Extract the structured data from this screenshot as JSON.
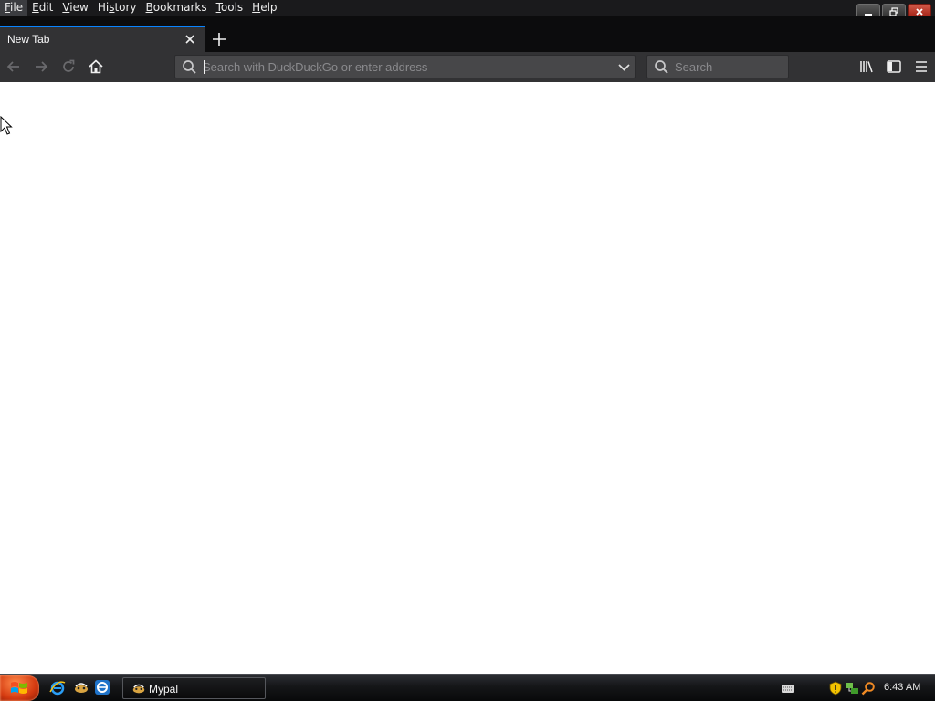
{
  "menubar": {
    "items": [
      {
        "first": "F",
        "rest": "ile"
      },
      {
        "first": "E",
        "rest": "dit"
      },
      {
        "first": "V",
        "rest": "iew"
      },
      {
        "first": "",
        "rest": "History"
      },
      {
        "first": "B",
        "rest": "ookmarks"
      },
      {
        "first": "T",
        "rest": "ools"
      },
      {
        "first": "H",
        "rest": "elp"
      }
    ],
    "history_pre": "Hi",
    "history_ul": "s",
    "history_post": "tory"
  },
  "tabs": [
    {
      "title": "New Tab",
      "active": true
    }
  ],
  "toolbar": {
    "url_placeholder": "Search with DuckDuckGo or enter address",
    "url_value": "",
    "search_placeholder": "Search",
    "icons": [
      "back-icon",
      "forward-icon",
      "reload-icon",
      "home-icon",
      "library-icon",
      "sidebar-icon",
      "menu-icon"
    ]
  },
  "taskbar": {
    "task_label": "Mypal",
    "clock": "6:43 AM",
    "quick_launch": [
      "ie-icon",
      "mypal-icon",
      "ie-alt-icon"
    ],
    "tray_icons": [
      "keyboard-icon",
      "shield-icon",
      "network-icon",
      "search-icon"
    ]
  },
  "colors": {
    "accent": "#0a84ff",
    "toolbar": "#323234",
    "tabstrip": "#0c0c0d",
    "start": "#d43a10"
  }
}
